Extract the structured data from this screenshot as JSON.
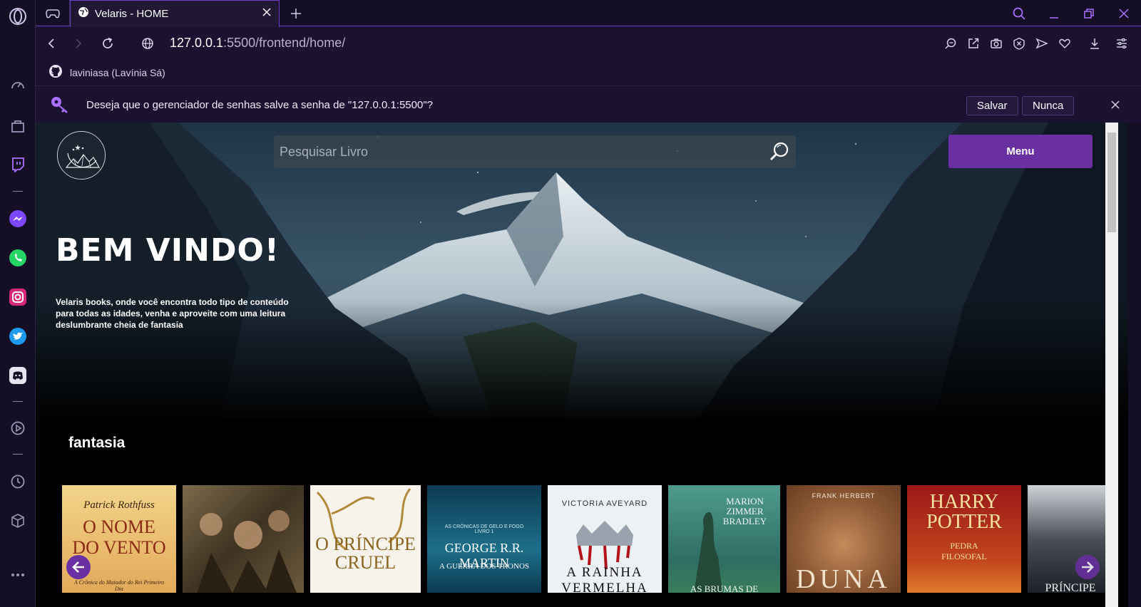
{
  "browser": {
    "tab_title": "Velaris - HOME",
    "url_host": "127.0.0.1",
    "url_path": ":5500/frontend/home/",
    "bookmark_label": "laviniasa (Lavínia Sá)"
  },
  "password_prompt": {
    "message": "Deseja que o gerenciador de senhas salve a senha de \"127.0.0.1:5500\"?",
    "save_label": "Salvar",
    "never_label": "Nunca"
  },
  "page": {
    "search_placeholder": "Pesquisar Livro",
    "menu_label": "Menu",
    "welcome_title": "BEM VINDO!",
    "welcome_text": "Velaris books, onde você encontra todo tipo de conteúdo para todas as idades, venha e aproveite com uma leitura deslumbrante cheia de fantasia",
    "section_title": "fantasia"
  },
  "books": [
    {
      "author": "Patrick Rothfuss",
      "title": "O NOME DO VENTO",
      "subtitle": "A Crônica do Matador do Rei Primeiro Dia"
    },
    {
      "author": "",
      "title": "",
      "subtitle": ""
    },
    {
      "author": "",
      "title": "O PRÍNCIPE CRUEL",
      "subtitle": ""
    },
    {
      "author": "GEORGE R.R. MARTIN",
      "title": "A GUERRA DOS TRONOS",
      "subtitle": "AS CRÔNICAS DE GELO E FOGO LIVRO 1"
    },
    {
      "author": "VICTORIA AVEYARD",
      "title": "A RAINHA VERMELHA",
      "subtitle": ""
    },
    {
      "author": "MARION ZIMMER BRADLEY",
      "title": "AS BRUMAS DE",
      "subtitle": ""
    },
    {
      "author": "FRANK HERBERT",
      "title": "DUNA",
      "subtitle": ""
    },
    {
      "author": "",
      "title": "HARRY POTTER",
      "subtitle": "PEDRA FILOSOFAL"
    },
    {
      "author": "",
      "title": "PRÍNCIPE",
      "subtitle": ""
    }
  ],
  "colors": {
    "accent": "#6b2fa4",
    "browser_bg": "#140f24"
  }
}
